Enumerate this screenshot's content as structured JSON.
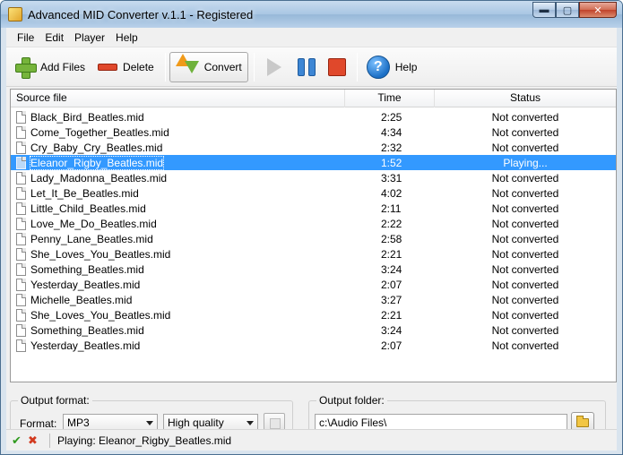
{
  "window": {
    "title": "Advanced MID Converter v.1.1 - Registered",
    "min_glyph": "▬",
    "max_glyph": "▢",
    "close_glyph": "✕"
  },
  "menu": [
    "File",
    "Edit",
    "Player",
    "Help"
  ],
  "toolbar": {
    "add_files": "Add Files",
    "delete": "Delete",
    "convert": "Convert",
    "help": "Help",
    "help_glyph": "?"
  },
  "table": {
    "columns": [
      "Source file",
      "Time",
      "Status"
    ],
    "rows": [
      {
        "file": "Black_Bird_Beatles.mid",
        "time": "2:25",
        "status": "Not converted"
      },
      {
        "file": "Come_Together_Beatles.mid",
        "time": "4:34",
        "status": "Not converted"
      },
      {
        "file": "Cry_Baby_Cry_Beatles.mid",
        "time": "2:32",
        "status": "Not converted"
      },
      {
        "file": "Eleanor_Rigby_Beatles.mid",
        "time": "1:52",
        "status": "Playing...",
        "selected": true
      },
      {
        "file": "Lady_Madonna_Beatles.mid",
        "time": "3:31",
        "status": "Not converted"
      },
      {
        "file": "Let_It_Be_Beatles.mid",
        "time": "4:02",
        "status": "Not converted"
      },
      {
        "file": "Little_Child_Beatles.mid",
        "time": "2:11",
        "status": "Not converted"
      },
      {
        "file": "Love_Me_Do_Beatles.mid",
        "time": "2:22",
        "status": "Not converted"
      },
      {
        "file": "Penny_Lane_Beatles.mid",
        "time": "2:58",
        "status": "Not converted"
      },
      {
        "file": "She_Loves_You_Beatles.mid",
        "time": "2:21",
        "status": "Not converted"
      },
      {
        "file": "Something_Beatles.mid",
        "time": "3:24",
        "status": "Not converted"
      },
      {
        "file": "Yesterday_Beatles.mid",
        "time": "2:07",
        "status": "Not converted"
      },
      {
        "file": "Michelle_Beatles.mid",
        "time": "3:27",
        "status": "Not converted"
      },
      {
        "file": "She_Loves_You_Beatles.mid",
        "time": "2:21",
        "status": "Not converted"
      },
      {
        "file": "Something_Beatles.mid",
        "time": "3:24",
        "status": "Not converted"
      },
      {
        "file": "Yesterday_Beatles.mid",
        "time": "2:07",
        "status": "Not converted"
      }
    ]
  },
  "output_format": {
    "title": "Output format:",
    "format_label": "Format:",
    "format_value": "MP3",
    "quality_value": "High quality"
  },
  "output_folder": {
    "title": "Output folder:",
    "path": "c:\\Audio Files\\"
  },
  "statusbar": {
    "ok_glyph": "✔",
    "cancel_glyph": "✖",
    "text": "Playing: Eleanor_Rigby_Beatles.mid"
  },
  "colors": {
    "selection": "#3399ff",
    "titlebar": "#a9c6e3"
  }
}
